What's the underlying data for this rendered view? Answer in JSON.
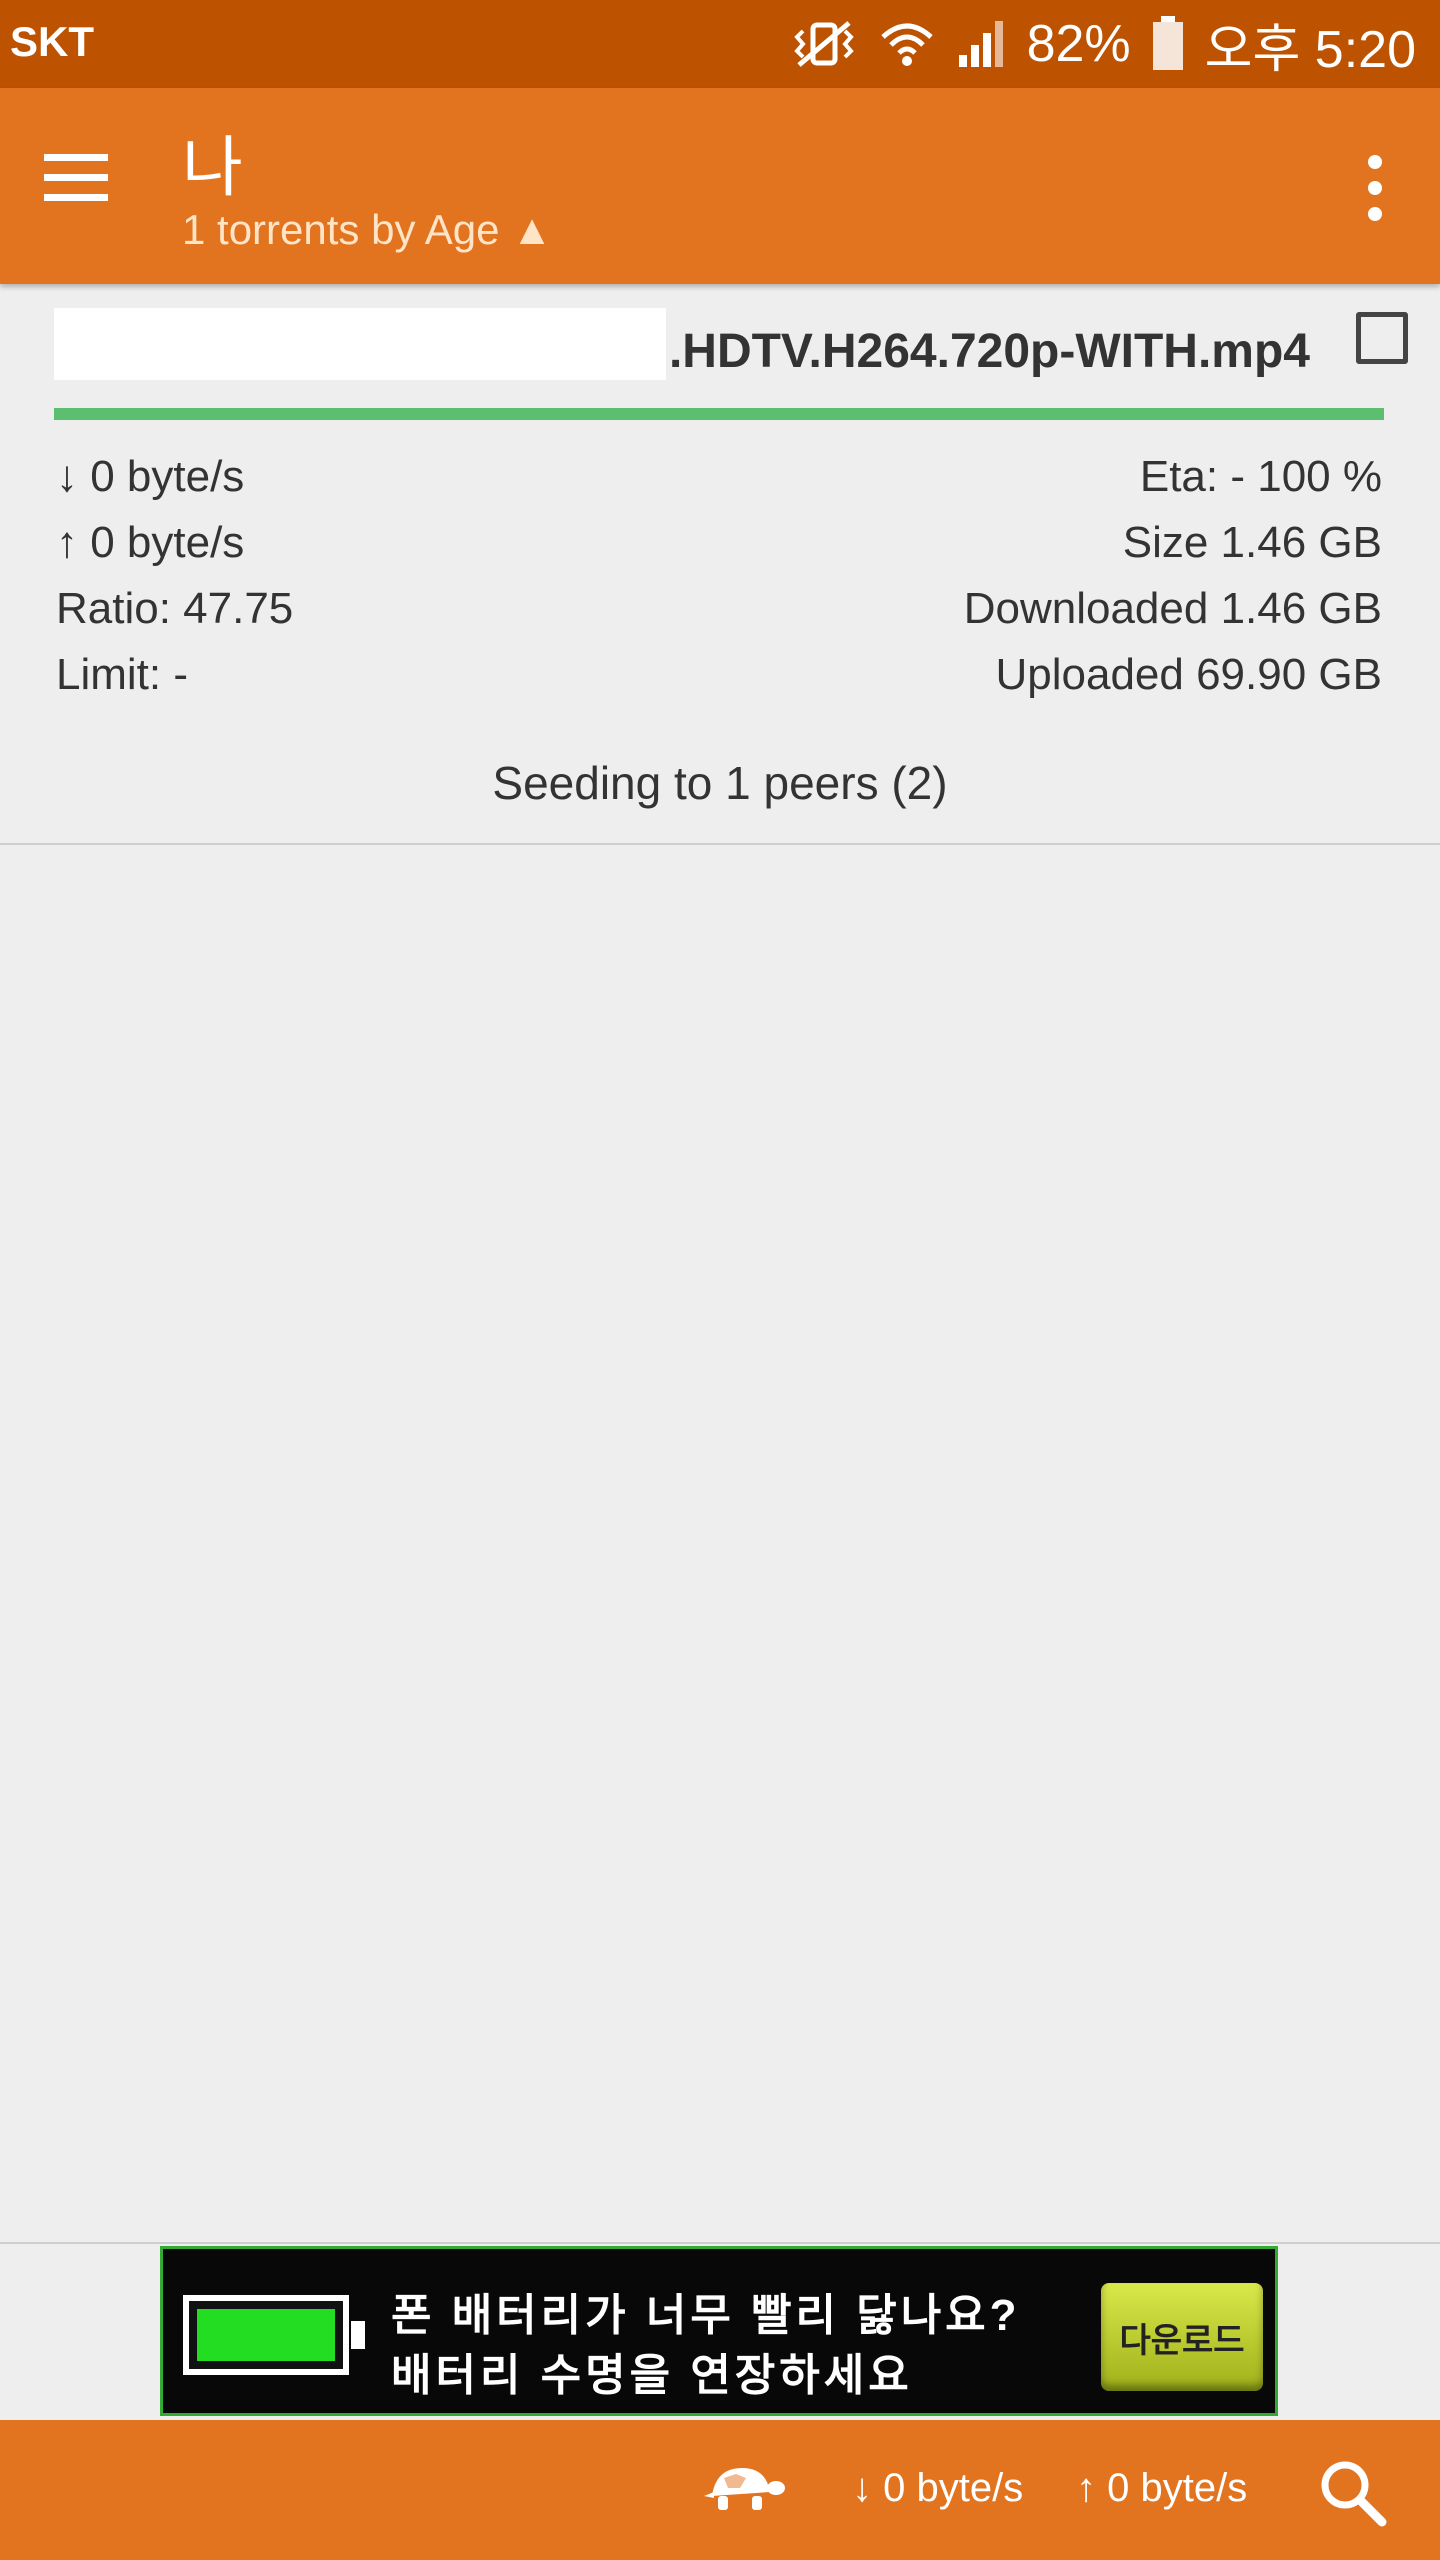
{
  "status_bar": {
    "carrier": "SKT",
    "icons": [
      "vibrate-icon",
      "wifi-icon",
      "signal-icon",
      "battery-icon"
    ],
    "battery": "82%",
    "time": "오후 5:20"
  },
  "app_bar": {
    "title": "나",
    "subtitle": "1 torrents by Age ▲",
    "color": "#e2731f"
  },
  "torrent": {
    "name": ".HDTV.H264.720p-WITH.mp4",
    "progress_percent": 100,
    "download_rate": "↓ 0 byte/s",
    "upload_rate": "↑ 0 byte/s",
    "ratio": "Ratio:  47.75",
    "limit": "Limit:  -",
    "eta": "Eta: -     100 %",
    "size": "Size 1.46 GB",
    "downloaded": "Downloaded 1.46 GB",
    "uploaded": "Uploaded 69.90 GB",
    "status": "Seeding to 1 peers (2)",
    "progress_color": "#5bbf6f"
  },
  "ad": {
    "line1": "폰 배터리가 너무 빨리 닳나요?",
    "line2": "배터리 수명을 연장하세요",
    "button": "다운로드"
  },
  "bottom_bar": {
    "download_rate": "↓ 0 byte/s",
    "upload_rate": "↑ 0 byte/s",
    "icons": [
      "turtle-icon",
      "search-icon"
    ]
  }
}
